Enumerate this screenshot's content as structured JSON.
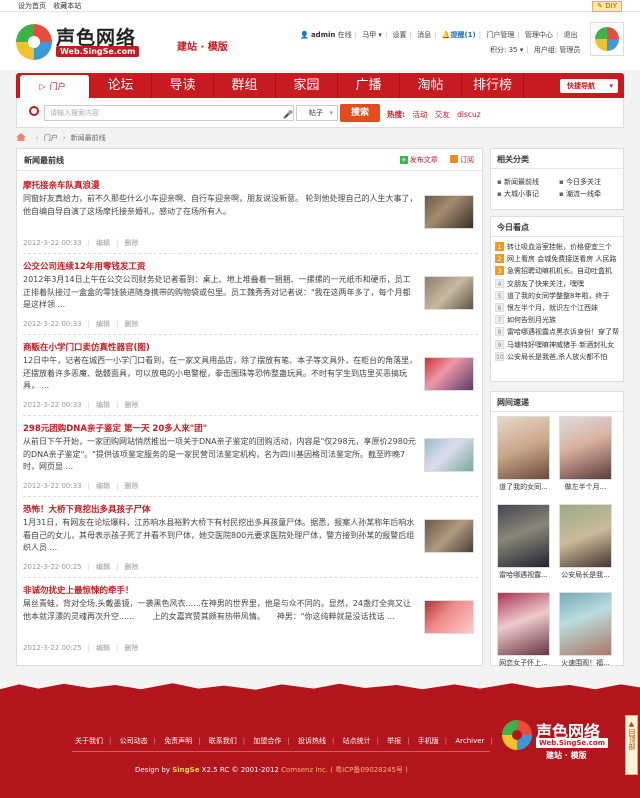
{
  "topbar": {
    "set_home": "设为首页",
    "bookmark": "收藏本站",
    "diy": "DIY"
  },
  "header": {
    "logo_name": "声色网络",
    "logo_url": "Web.SingSe.com",
    "slogan": "建站 · 模版",
    "user": {
      "name": "admin",
      "status": "在线",
      "ma": "马甲",
      "settings": "设置",
      "messages": "消息",
      "remind": "提醒(1)",
      "portal_mgmt": "门户管理",
      "admin_center": "管理中心",
      "logout": "退出",
      "points": "积分: 35",
      "group": "用户组: 管理员"
    }
  },
  "nav": {
    "items": [
      "门户",
      "论坛",
      "导读",
      "群组",
      "家园",
      "广播",
      "淘帖",
      "排行榜"
    ],
    "quick": "快捷导航"
  },
  "search": {
    "placeholder": "请输入搜索内容",
    "type": "帖子",
    "button": "搜索",
    "hot_label": "热搜:",
    "hot": [
      "活动",
      "交友",
      "discuz"
    ]
  },
  "breadcrumb": {
    "home": "门户",
    "current": "新闻最前线"
  },
  "main": {
    "title": "新闻最前线",
    "publish": "发布文章",
    "subscribe": "订阅",
    "articles": [
      {
        "title": "摩托接亲车队真浪漫",
        "body": "同窗好友真给力，前不久那些什么小车迎亲啊、自行车迎亲啊，朋友说没新意。 轮到他处理自己的人生大事了，他自编自导自演了这场摩托接亲婚礼，感动了在场所有人。",
        "date": "2012-3-22 00:33",
        "edit": "编辑",
        "delete": "删除"
      },
      {
        "title": "公交公司连续12年用零钱发工资",
        "body": "2012年3月14日上午在公交公司财务处记者看到：桌上、地上堆叠着一捆捆、一摞摞的一元纸币和硬币，员工正排着队接过一盒盒的零钱装进随身携带的购物袋或包里。员工魏秀秀对记者说：\"我在这两年多了，每个月都是这样领 ...",
        "date": "2012-3-22 00:33",
        "edit": "编辑",
        "delete": "删除"
      },
      {
        "title": "商贩在小学门口卖仿真性器官(图)",
        "body": "12日中午，记者在城西一小学门口看到，在一家文具用品店，除了摆放有笔、本子等文具外，在柜台的角落里，还摆放着许多恶魔、骷髅面具，可以放电的小电警棍，拳击围珠等恐怖整蛊玩具。不时有学生到店里买恶搞玩具， ...",
        "date": "2012-3-22 00:33",
        "edit": "编辑",
        "delete": "删除"
      },
      {
        "title": "298元团购DNA亲子鉴定 第一天 20多人来\"团\"",
        "body": "从前日下午开始，一家团购网站悄然推出一项关于DNA亲子鉴定的团购活动，内容是\"仅298元，享原价2980元的DNA亲子鉴定\"。\"提供该项鉴定服务的是一家民营司法鉴定机构，名为四川基因格司法鉴定所。截至昨晚7时，网页显 ...",
        "date": "2012-3-22 00:33",
        "edit": "编辑",
        "delete": "删除"
      },
      {
        "title": "恐怖！大桥下竟挖出多具孩子尸体",
        "body": "1月31日，有网友在论坛爆料，江苏响水县裕黔大桥下有村民挖出多具孩童尸体。据悉，报案人孙某称年后响水看自己的女儿，其母表示孩子死了并看不到尸体，她交医院800元要求医院处理尸体，警方接到孙某的报警后组织人员 ...",
        "date": "2012-3-22 00:25",
        "edit": "编辑",
        "delete": "删除"
      },
      {
        "title": "非诚勿扰史上最惊悚的牵手！",
        "body": "屌丝青蛙，背对全场,头戴墨镜，一袭黑色风衣......在神男的世界里，他是与众不同的。显然，24盏灯全亮又让他本就浮漂的灵魂再次升空...... 　　上的女嘉宾赞其颇有热带风情。　　神男：\"你这纯粹就是没话找话 ...",
        "date": "2012-3-22 00:25",
        "edit": "编辑",
        "delete": "删除"
      }
    ]
  },
  "sidebar": {
    "related": {
      "title": "相关分类",
      "items": [
        "新闻最前线",
        "今日多关注",
        "大城小事记",
        "潮流一线牵"
      ]
    },
    "today": {
      "title": "今日看点",
      "items": [
        "转让吸血浴室挂帐，价格便宜三个",
        "网上看房 会城免费接送看房 人民路",
        "急需招聘动嘛机机长。自动吐盒机",
        "交朋友了快来关注，嘿嘿",
        "道了我的女同学整整8年啦，终于",
        "恨左半个月，就识左个江西妹",
        "如何告别月光族",
        "雷哈哪遇视露点黑衣诉身份！穿了帮",
        "马塘特好嘿嘛神威猪手 新酒封礼女",
        "公安局长是我爸,杀人放火都不怕"
      ]
    },
    "photos": {
      "title": "网间速递",
      "items": [
        "道了我的女同...",
        "做左半个月...",
        "",
        "",
        "雷哈哪遇视露...",
        "公安局长是我...",
        "",
        "",
        "网恋女子怀上...",
        "火速围观！福..."
      ]
    }
  },
  "footer": {
    "links": [
      "关于我们",
      "公司动态",
      "免责声明",
      "联系我们",
      "加盟合作",
      "投诉热线",
      "站点统计",
      "举报",
      "手机版",
      "Archiver"
    ],
    "copy_prefix": "Design by",
    "brand": "SingSe",
    "copy_mid": "X2.5 RC © 2001-2012",
    "company": "Comsenz Inc.",
    "icp": "( 粤ICP备09028245号 )",
    "logo_name": "声色网络",
    "logo_url": "Web.SingSe.com",
    "slogan": "建站 · 模版",
    "back_top": "回顶部"
  }
}
